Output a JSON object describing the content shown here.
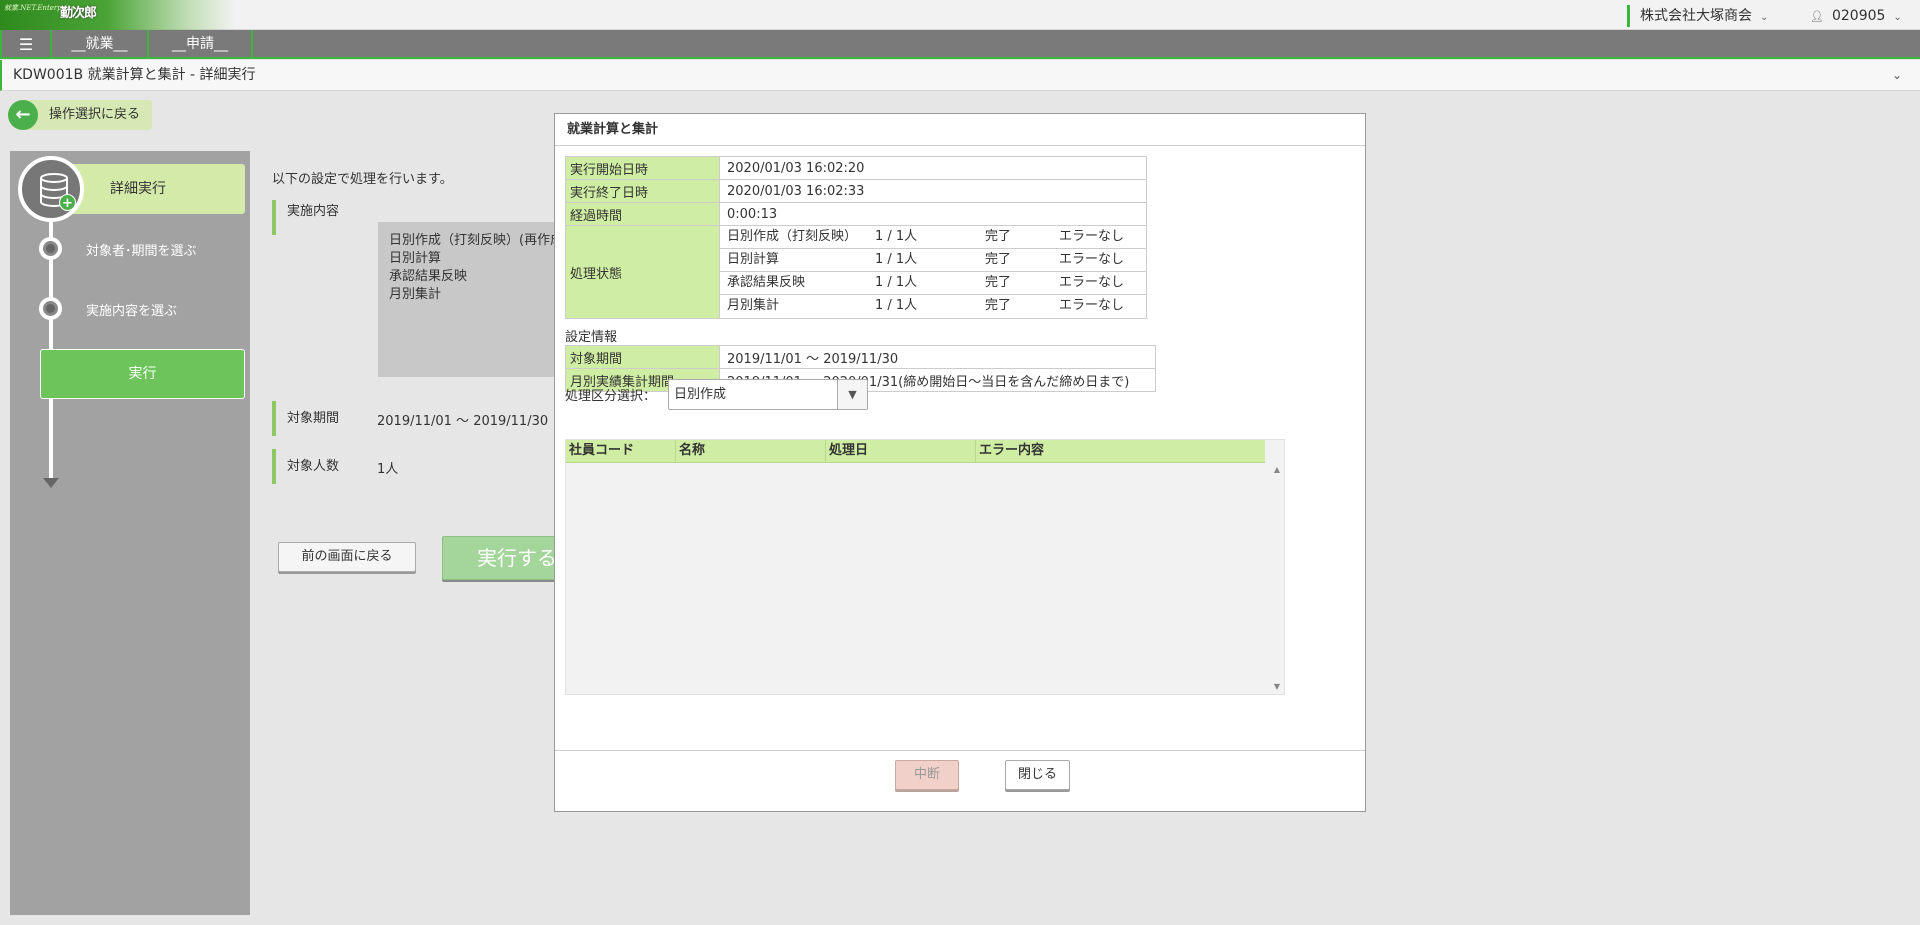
{
  "header": {
    "logo_text": "就業.NET.Enterprise",
    "logo_mark": "勤次郎",
    "company": "株式会社大塚商会",
    "user_id": "020905"
  },
  "nav": {
    "menu_icon": "hamburger-icon",
    "tabs": [
      "__就業__",
      "__申請__"
    ]
  },
  "page": {
    "title": "KDW001B 就業計算と集計 - 詳細実行"
  },
  "back_button": {
    "label": "操作選択に戻る"
  },
  "steps": {
    "items": [
      {
        "label": "詳細実行"
      },
      {
        "label": "対象者･期間を選ぶ"
      },
      {
        "label": "実施内容を選ぶ"
      },
      {
        "label": "実行"
      }
    ]
  },
  "main": {
    "intro": "以下の設定で処理を行います。",
    "content_label": "実施内容",
    "content_items": [
      "日別作成（打刻反映）(再作成)",
      "日別計算",
      "承認結果反映",
      "月別集計"
    ],
    "period_label": "対象期間",
    "period_value": "2019/11/01 ～ 2019/11/30",
    "count_label": "対象人数",
    "count_value": "1人",
    "prev_button": "前の画面に戻る",
    "run_button": "実行する"
  },
  "dialog": {
    "title": "就業計算と集計",
    "start_label": "実行開始日時",
    "start_value": "2020/01/03 16:02:20",
    "end_label": "実行終了日時",
    "end_value": "2020/01/03 16:02:33",
    "elapsed_label": "経過時間",
    "elapsed_value": "0:00:13",
    "status_label": "処理状態",
    "status_rows": [
      {
        "name": "日別作成（打刻反映）",
        "count": "1 / 1人",
        "state": "完了",
        "error": "エラーなし"
      },
      {
        "name": "日別計算",
        "count": "1 / 1人",
        "state": "完了",
        "error": "エラーなし"
      },
      {
        "name": "承認結果反映",
        "count": "1 / 1人",
        "state": "完了",
        "error": "エラーなし"
      },
      {
        "name": "月別集計",
        "count": "1 / 1人",
        "state": "完了",
        "error": "エラーなし"
      }
    ],
    "settings_title": "設定情報",
    "target_period_label": "対象期間",
    "target_period_value": "2019/11/01 ～ 2019/11/30",
    "monthly_period_label": "月別実績集計期間",
    "monthly_period_value": "2019/11/01 ～ 2020/01/31(締め開始日～当日を含んだ締め日まで)",
    "select_label": "処理区分選択：",
    "select_value": "日別作成",
    "grid_columns": [
      "社員コード",
      "名称",
      "処理日",
      "エラー内容"
    ],
    "abort_button": "中断",
    "close_button": "閉じる"
  }
}
